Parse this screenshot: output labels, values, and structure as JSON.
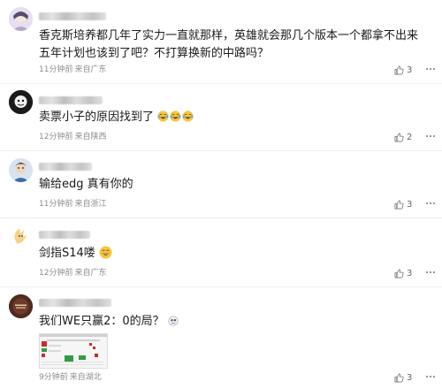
{
  "comments": [
    {
      "text_line1": "香克斯培养都几年了实力一直就那样，英雄就会那几个版本一个都拿不出来",
      "text_line2": "五年计划也该到了吧？不打算换新的中路吗？",
      "time": "11分钟前",
      "location": "来自广东",
      "likes": "3"
    },
    {
      "text": "卖票小子的原因找到了",
      "time": "12分钟前",
      "location": "来自陕西",
      "likes": "2"
    },
    {
      "text": "输给edg 真有你的",
      "time": "11分钟前",
      "location": "来自浙江",
      "likes": "3"
    },
    {
      "text": "剑指S14喽",
      "time": "12分钟前",
      "location": "来自广东",
      "likes": "3"
    },
    {
      "text": "我们WE只赢2：0的局？",
      "time": "9分钟前",
      "location": "来自湖北",
      "likes": "3"
    }
  ],
  "icons": {
    "like": "thumbs-up-icon",
    "more": "more-dots-icon",
    "emoji_laugh_cry": "tears-of-joy-emoji",
    "emoji_grin": "grinning-emoji"
  },
  "colors": {
    "meta_text": "#8c8c8c",
    "divider": "#efefef",
    "text": "#1a1a1a"
  }
}
